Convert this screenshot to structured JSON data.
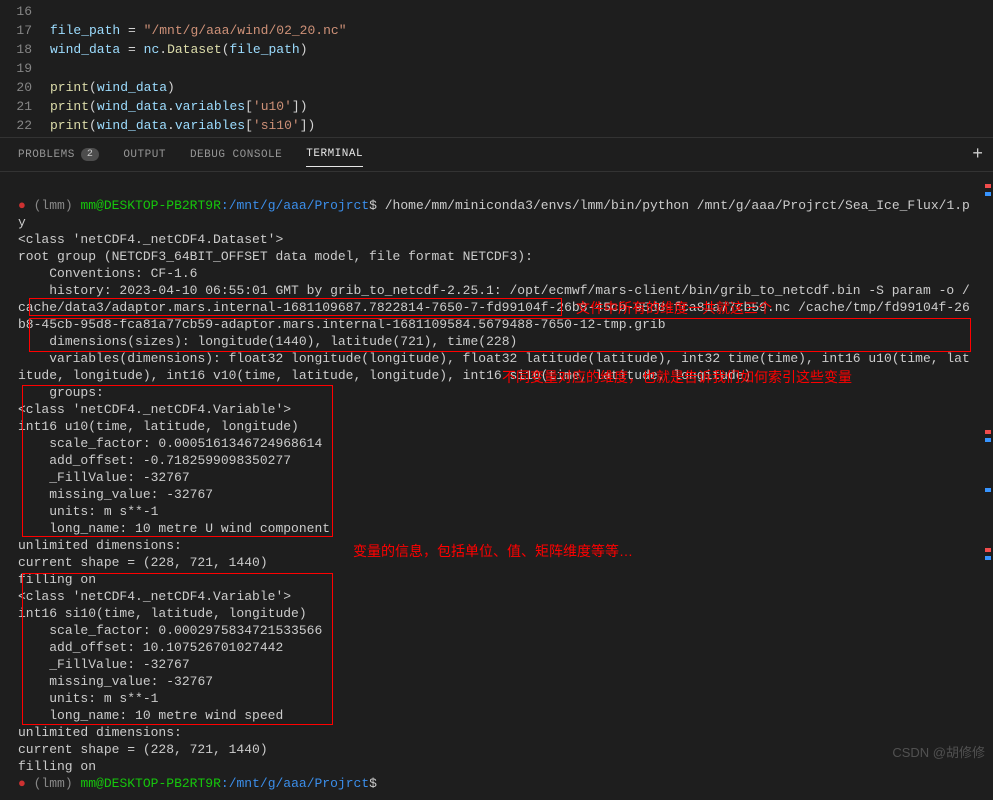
{
  "editor": {
    "lines": [
      {
        "num": "16",
        "html": ""
      },
      {
        "num": "17",
        "html": "<span class='var'>file_path</span> <span class='op'>=</span> <span class='str'>\"/mnt/g/aaa/wind/02_20.nc\"</span>"
      },
      {
        "num": "18",
        "html": "<span class='var'>wind_data</span> <span class='op'>=</span> <span class='var'>nc</span>.<span class='fn'>Dataset</span>(<span class='var'>file_path</span>)"
      },
      {
        "num": "19",
        "html": ""
      },
      {
        "num": "20",
        "html": "<span class='fn'>print</span>(<span class='var'>wind_data</span>)"
      },
      {
        "num": "21",
        "html": "<span class='fn'>print</span>(<span class='var'>wind_data</span>.<span class='var'>variables</span>[<span class='str'>'u10'</span>])"
      },
      {
        "num": "22",
        "html": "<span class='fn'>print</span>(<span class='var'>wind_data</span>.<span class='var'>variables</span>[<span class='str'>'si10'</span>])"
      }
    ]
  },
  "tabs": {
    "problems": "PROBLEMS",
    "problems_count": "2",
    "output": "OUTPUT",
    "debug": "DEBUG CONSOLE",
    "terminal": "TERMINAL"
  },
  "terminal": {
    "bullet": "●",
    "env": "(lmm)",
    "user_host": "mm@DESKTOP-PB2RT9R",
    "cwd": ":/mnt/g/aaa/Projrct",
    "dollar": "$",
    "cmd": "/home/mm/miniconda3/envs/lmm/bin/python /mnt/g/aaa/Projrct/Sea_Ice_Flux/1.py",
    "out1": "<class 'netCDF4._netCDF4.Dataset'>",
    "out2": "root group (NETCDF3_64BIT_OFFSET data model, file format NETCDF3):",
    "out3": "    Conventions: CF-1.6",
    "out4": "    history: 2023-04-10 06:55:01 GMT by grib_to_netcdf-2.25.1: /opt/ecmwf/mars-client/bin/grib_to_netcdf.bin -S param -o /cache/data3/adaptor.mars.internal-1681109687.7822814-7650-7-fd99104f-26b8-45cb-95d8-fca81a77cb59.nc /cache/tmp/fd99104f-26b8-45cb-95d8-fca81a77cb59-adaptor.mars.internal-1681109584.5679488-7650-12-tmp.grib",
    "out5": "    dimensions(sizes): longitude(1440), latitude(721), time(228)",
    "out6": "    variables(dimensions): float32 longitude(longitude), float32 latitude(latitude), int32 time(time), int16 u10(time, latitude, longitude), int16 v10(time, latitude, longitude), int16 si10(time, latitude, longitude)",
    "out7": "    groups:",
    "out8": "<class 'netCDF4._netCDF4.Variable'>",
    "out9": "int16 u10(time, latitude, longitude)",
    "out10": "    scale_factor: 0.0005161346724968614",
    "out11": "    add_offset: -0.7182599098350277",
    "out12": "    _FillValue: -32767",
    "out13": "    missing_value: -32767",
    "out14": "    units: m s**-1",
    "out15": "    long_name: 10 metre U wind component",
    "out16": "unlimited dimensions:",
    "out17": "current shape = (228, 721, 1440)",
    "out18": "filling on",
    "out19": "<class 'netCDF4._netCDF4.Variable'>",
    "out20": "int16 si10(time, latitude, longitude)",
    "out21": "    scale_factor: 0.0002975834721533566",
    "out22": "    add_offset: 10.107526701027442",
    "out23": "    _FillValue: -32767",
    "out24": "    missing_value: -32767",
    "out25": "    units: m s**-1",
    "out26": "    long_name: 10 metre wind speed",
    "out27": "unlimited dimensions:",
    "out28": "current shape = (228, 721, 1440)",
    "out29": "filling on"
  },
  "annotations": {
    "a1": "文件中所有的维度一共就这三个",
    "a2": "不同变量对应的维度，也就是告诉我们如何索引这些变量",
    "a3": "变量的信息，包括单位、值、矩阵维度等等…"
  },
  "watermark": "CSDN @胡修修"
}
